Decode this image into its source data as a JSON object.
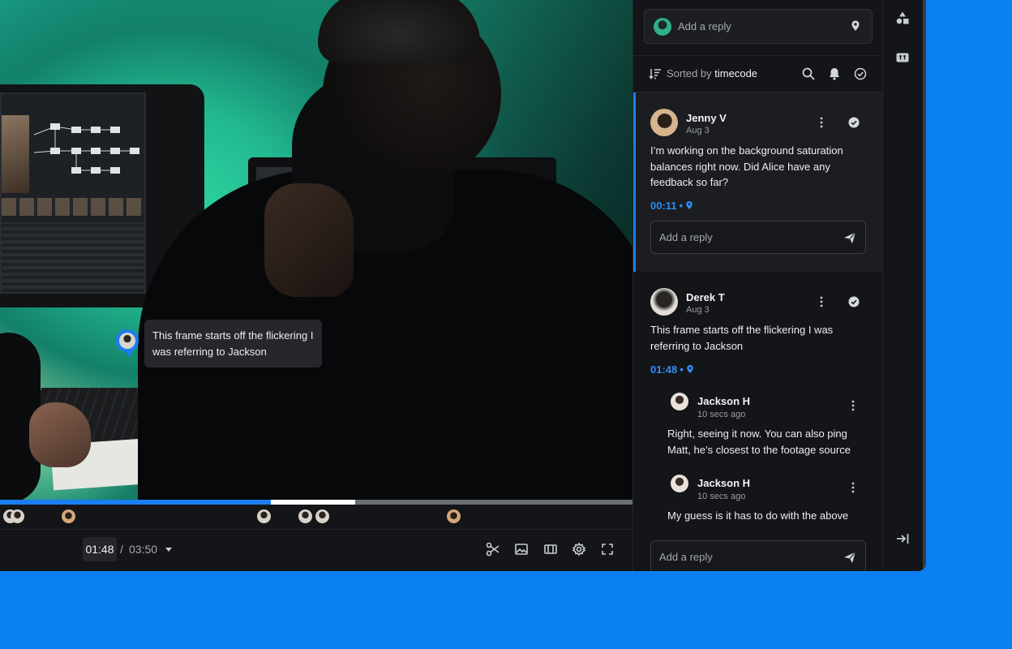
{
  "video": {
    "annotation_text": "This frame starts off the flickering I was referring to Jackson"
  },
  "player": {
    "current_time": "01:48",
    "separator": "/",
    "total_time": "03:50",
    "played_fraction": 0.428,
    "buffered_end_fraction": 0.562
  },
  "panel": {
    "top_reply_placeholder": "Add a reply",
    "sort_prefix": "Sorted by",
    "sort_value": "timecode",
    "threads": [
      {
        "author": "Jenny V",
        "date": "Aug 3",
        "body": "I’m working on the background saturation balances right now. Did Alice have any feedback so far?",
        "timecode": "00:11",
        "dot": "•",
        "reply_placeholder": "Add a reply"
      },
      {
        "author": "Derek T",
        "date": "Aug 3",
        "body": "This frame starts off the flickering I was referring to Jackson",
        "timecode": "01:48",
        "dot": "•",
        "replies": [
          {
            "author": "Jackson H",
            "date": "10 secs ago",
            "body": "Right, seeing it now. You can also ping Matt, he’s closest to the footage source"
          },
          {
            "author": "Jackson H",
            "date": "10 secs ago",
            "body": "My guess is it has to do with the above"
          }
        ],
        "reply_placeholder": "Add a reply"
      }
    ]
  },
  "colors": {
    "accent": "#1b7ef2",
    "background": "#0a80f0",
    "panel": "#141518"
  },
  "icons": [
    "location-pin-icon",
    "sort-icon",
    "search-icon",
    "bell-icon",
    "check-circle-icon",
    "kebab-icon",
    "send-icon",
    "scissors-icon",
    "image-icon",
    "aspect-ratio-icon",
    "gear-icon",
    "fullscreen-icon",
    "shapes-icon",
    "caption-icon",
    "collapse-panel-icon",
    "dropdown-caret-icon"
  ]
}
